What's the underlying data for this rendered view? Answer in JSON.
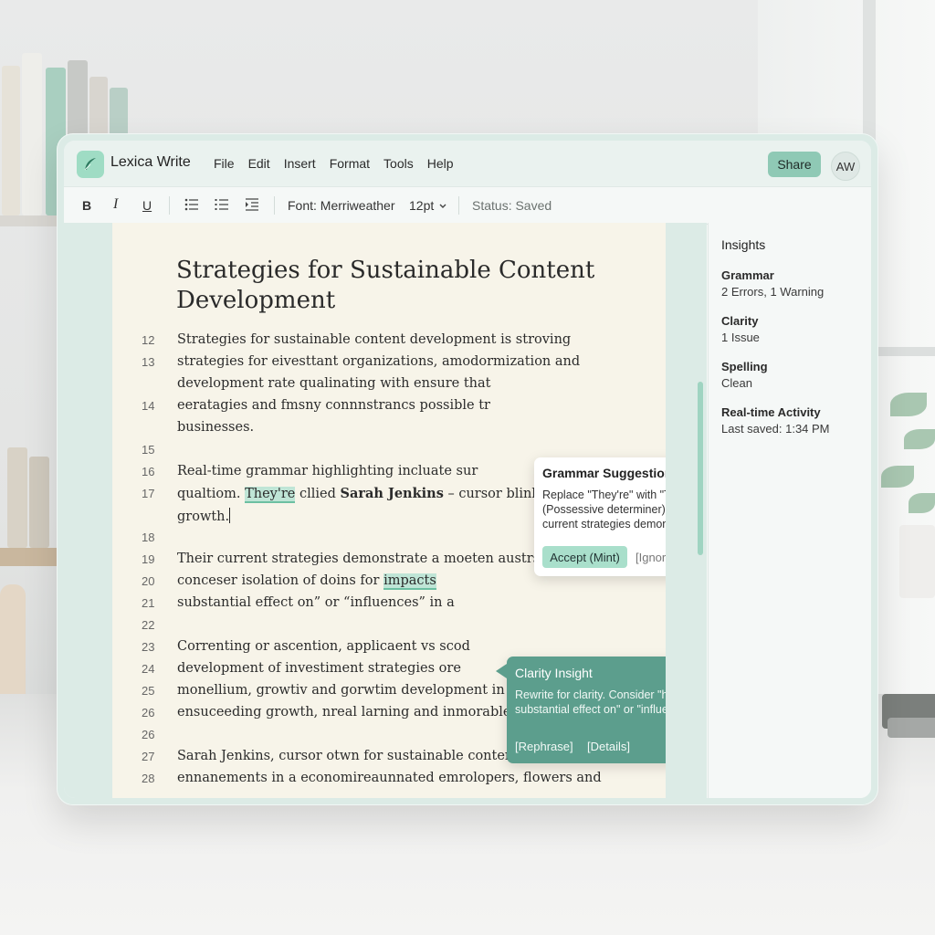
{
  "app": {
    "name": "Lexica Write"
  },
  "menu": [
    "File",
    "Edit",
    "Insert",
    "Format",
    "Tools",
    "Help"
  ],
  "header": {
    "share_label": "Share",
    "avatar_initials": "AW"
  },
  "toolbar": {
    "bold": "B",
    "italic": "I",
    "underline": "U",
    "font_label": "Font: Merriweather",
    "size_label": "12pt",
    "status": "Status: Saved"
  },
  "document": {
    "title": "Strategies for Sustainable Content Development",
    "lines": [
      {
        "n": "12",
        "text": " Strategies for sustainable content development is stroving"
      },
      {
        "n": "13",
        "text": "strategies for eivesttant organizations, amodormization and"
      },
      {
        "n": "",
        "text": "development rate qualinating with ensure that"
      },
      {
        "n": "14",
        "text": "eeratagies and fmsny connnstrancs possible tr"
      },
      {
        "n": "",
        "text": "businesses."
      },
      {
        "n": "15",
        "text": ""
      },
      {
        "n": "16",
        "text": " Real-time grammar highlighting incluate sur"
      },
      {
        "n": "17",
        "text": ""
      },
      {
        "n": "",
        "text": ""
      },
      {
        "n": "18",
        "text": ""
      },
      {
        "n": "19",
        "text": "Their current strategies demonstrate a moeten austrs and"
      },
      {
        "n": "20",
        "text": ""
      },
      {
        "n": "21",
        "text": " substantial effect on” or “influences” in a"
      },
      {
        "n": "22",
        "text": ""
      },
      {
        "n": "23",
        "text": "Correnting or ascention, applicaent vs scod"
      },
      {
        "n": "24",
        "text": "development of investiment strategies ore"
      },
      {
        "n": "25",
        "text": "monellium, growtiv and gorwtim development in strategies of"
      },
      {
        "n": "26",
        "text": "ensuceeding growth, nreal larning and inmorable oncretures."
      },
      {
        "n": "26",
        "text": ""
      },
      {
        "n": "27",
        "text": "Sarah Jenkins, cursor otwn for sustainable content"
      },
      {
        "n": "28",
        "text": "ennanements in a economireaunnated emrolopers, flowers and"
      }
    ],
    "line17": {
      "pre": "qualtiom. ",
      "highlight": "They're",
      "mid": " cllied ",
      "bold": "Sarah Jenkins",
      "post": " – cursor blinking after"
    },
    "line17b": "growth.",
    "line20": {
      "pre": "conceser isolation of doins for ",
      "highlight": "impacts"
    }
  },
  "insights": {
    "title": "Insights",
    "items": [
      {
        "label": "Grammar",
        "value": "2 Errors, 1 Warning"
      },
      {
        "label": "Clarity",
        "value": "1 Issue"
      },
      {
        "label": "Spelling",
        "value": "Clean"
      },
      {
        "label": "Real-time Activity",
        "value": "Last saved: 1:34 PM"
      }
    ]
  },
  "grammar_popup": {
    "title": "Grammar Suggestion",
    "body": "Replace \"They're\" with \"Their\" (Possessive determiner). Their current strategies demonstrate...",
    "accept": "Accept (Mint)",
    "ignore": "[Ignore]"
  },
  "clarity_popup": {
    "title": "Clarity Insight",
    "body": "Rewrite for clarity. Consider \"has a substantial effect on\" or \"influences\"",
    "rephrase": "[Rephrase]",
    "details": "[Details]"
  },
  "colors": {
    "accent": "#8fc9b5",
    "highlight": "#bfe5d6",
    "clarity": "#5c9e8d",
    "paper": "#f7f4e9"
  }
}
